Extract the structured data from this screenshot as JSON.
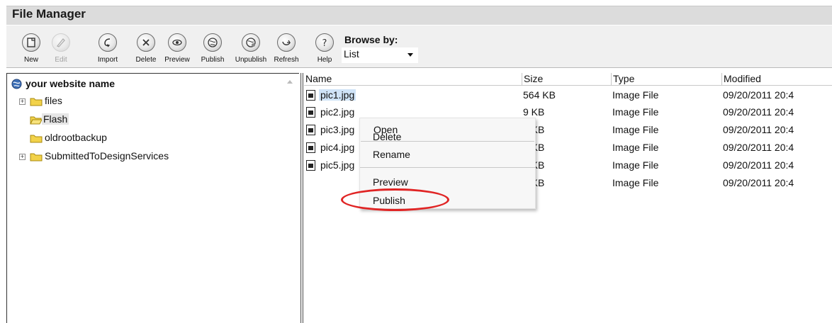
{
  "window": {
    "title": "File Manager"
  },
  "toolbar": {
    "buttons": [
      {
        "label": "New",
        "icon": "new-file-icon",
        "enabled": true
      },
      {
        "label": "Edit",
        "icon": "pencil-icon",
        "enabled": false
      },
      {
        "label": "Import",
        "icon": "import-icon",
        "enabled": true
      },
      {
        "label": "Delete",
        "icon": "delete-x-icon",
        "enabled": true
      },
      {
        "label": "Preview",
        "icon": "eye-icon",
        "enabled": true
      },
      {
        "label": "Publish",
        "icon": "globe-icon",
        "enabled": true
      },
      {
        "label": "Unpublish",
        "icon": "globe-unpublish-icon",
        "enabled": true
      },
      {
        "label": "Refresh",
        "icon": "refresh-icon",
        "enabled": true
      },
      {
        "label": "Help",
        "icon": "help-icon",
        "enabled": true
      }
    ],
    "browse_label": "Browse by:",
    "browse_value": "List"
  },
  "tree": {
    "root": "your website name",
    "nodes": [
      {
        "label": "files",
        "expandable": true,
        "expander": "+"
      },
      {
        "label": "Flash",
        "expandable": false,
        "selected": true
      },
      {
        "label": "oldrootbackup",
        "expandable": false
      },
      {
        "label": "SubmittedToDesignServices",
        "expandable": true,
        "expander": "+"
      }
    ]
  },
  "list": {
    "columns": [
      "Name",
      "Size",
      "Type",
      "Modified"
    ],
    "rows": [
      {
        "name": "pic1.jpg",
        "size": "564 KB",
        "type": "Image File",
        "modified": "09/20/2011 20:4"
      },
      {
        "name": "pic2.jpg",
        "size": "9 KB",
        "type": "Image File",
        "modified": "09/20/2011 20:4"
      },
      {
        "name": "pic3.jpg",
        "size": "3 KB",
        "type": "Image File",
        "modified": "09/20/2011 20:4"
      },
      {
        "name": "pic4.jpg",
        "size": "9 KB",
        "type": "Image File",
        "modified": "09/20/2011 20:4"
      },
      {
        "name": "pic5.jpg",
        "size": "7 KB",
        "type": "Image File",
        "modified": "09/20/2011 20:4"
      },
      {
        "name": "",
        "size": "9 KB",
        "type": "Image File",
        "modified": "09/20/2011 20:4"
      }
    ]
  },
  "context_menu": {
    "items": [
      "Open",
      "Delete",
      "Rename",
      "Preview",
      "Publish"
    ]
  },
  "colors": {
    "highlight_ellipse": "#e02424",
    "selection": "#cfe3f7"
  }
}
